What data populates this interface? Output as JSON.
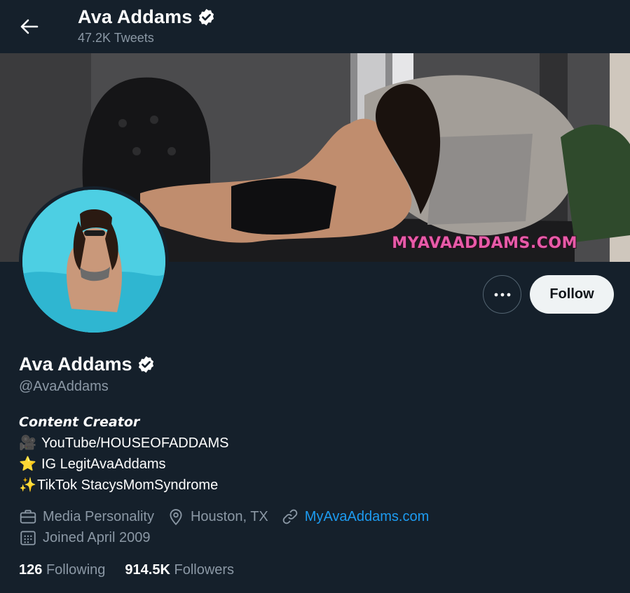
{
  "header": {
    "name": "Ava Addams",
    "tweet_count": "47.2K Tweets"
  },
  "banner": {
    "watermark": "MYAVAADDAMS.COM"
  },
  "actions": {
    "follow_label": "Follow"
  },
  "profile": {
    "name": "Ava Addams",
    "handle": "@AvaAddams",
    "bio": {
      "title": "Content Creator",
      "lines": [
        {
          "emoji": "🎥",
          "text": "YouTube/HOUSEOFADDAMS"
        },
        {
          "emoji": "⭐",
          "text": "IG LegitAvaAddams"
        },
        {
          "emoji": "✨",
          "text": "TikTok StacysMomSyndrome"
        }
      ]
    },
    "meta": {
      "category": "Media Personality",
      "location": "Houston, TX",
      "website": "MyAvaAddams.com",
      "joined": "Joined April 2009"
    },
    "stats": {
      "following_count": "126",
      "following_label": "Following",
      "followers_count": "914.5K",
      "followers_label": "Followers"
    }
  },
  "colors": {
    "background": "#15202b",
    "secondary_text": "#8b98a5",
    "link": "#1d9bf0",
    "watermark": "#e85aa8"
  }
}
